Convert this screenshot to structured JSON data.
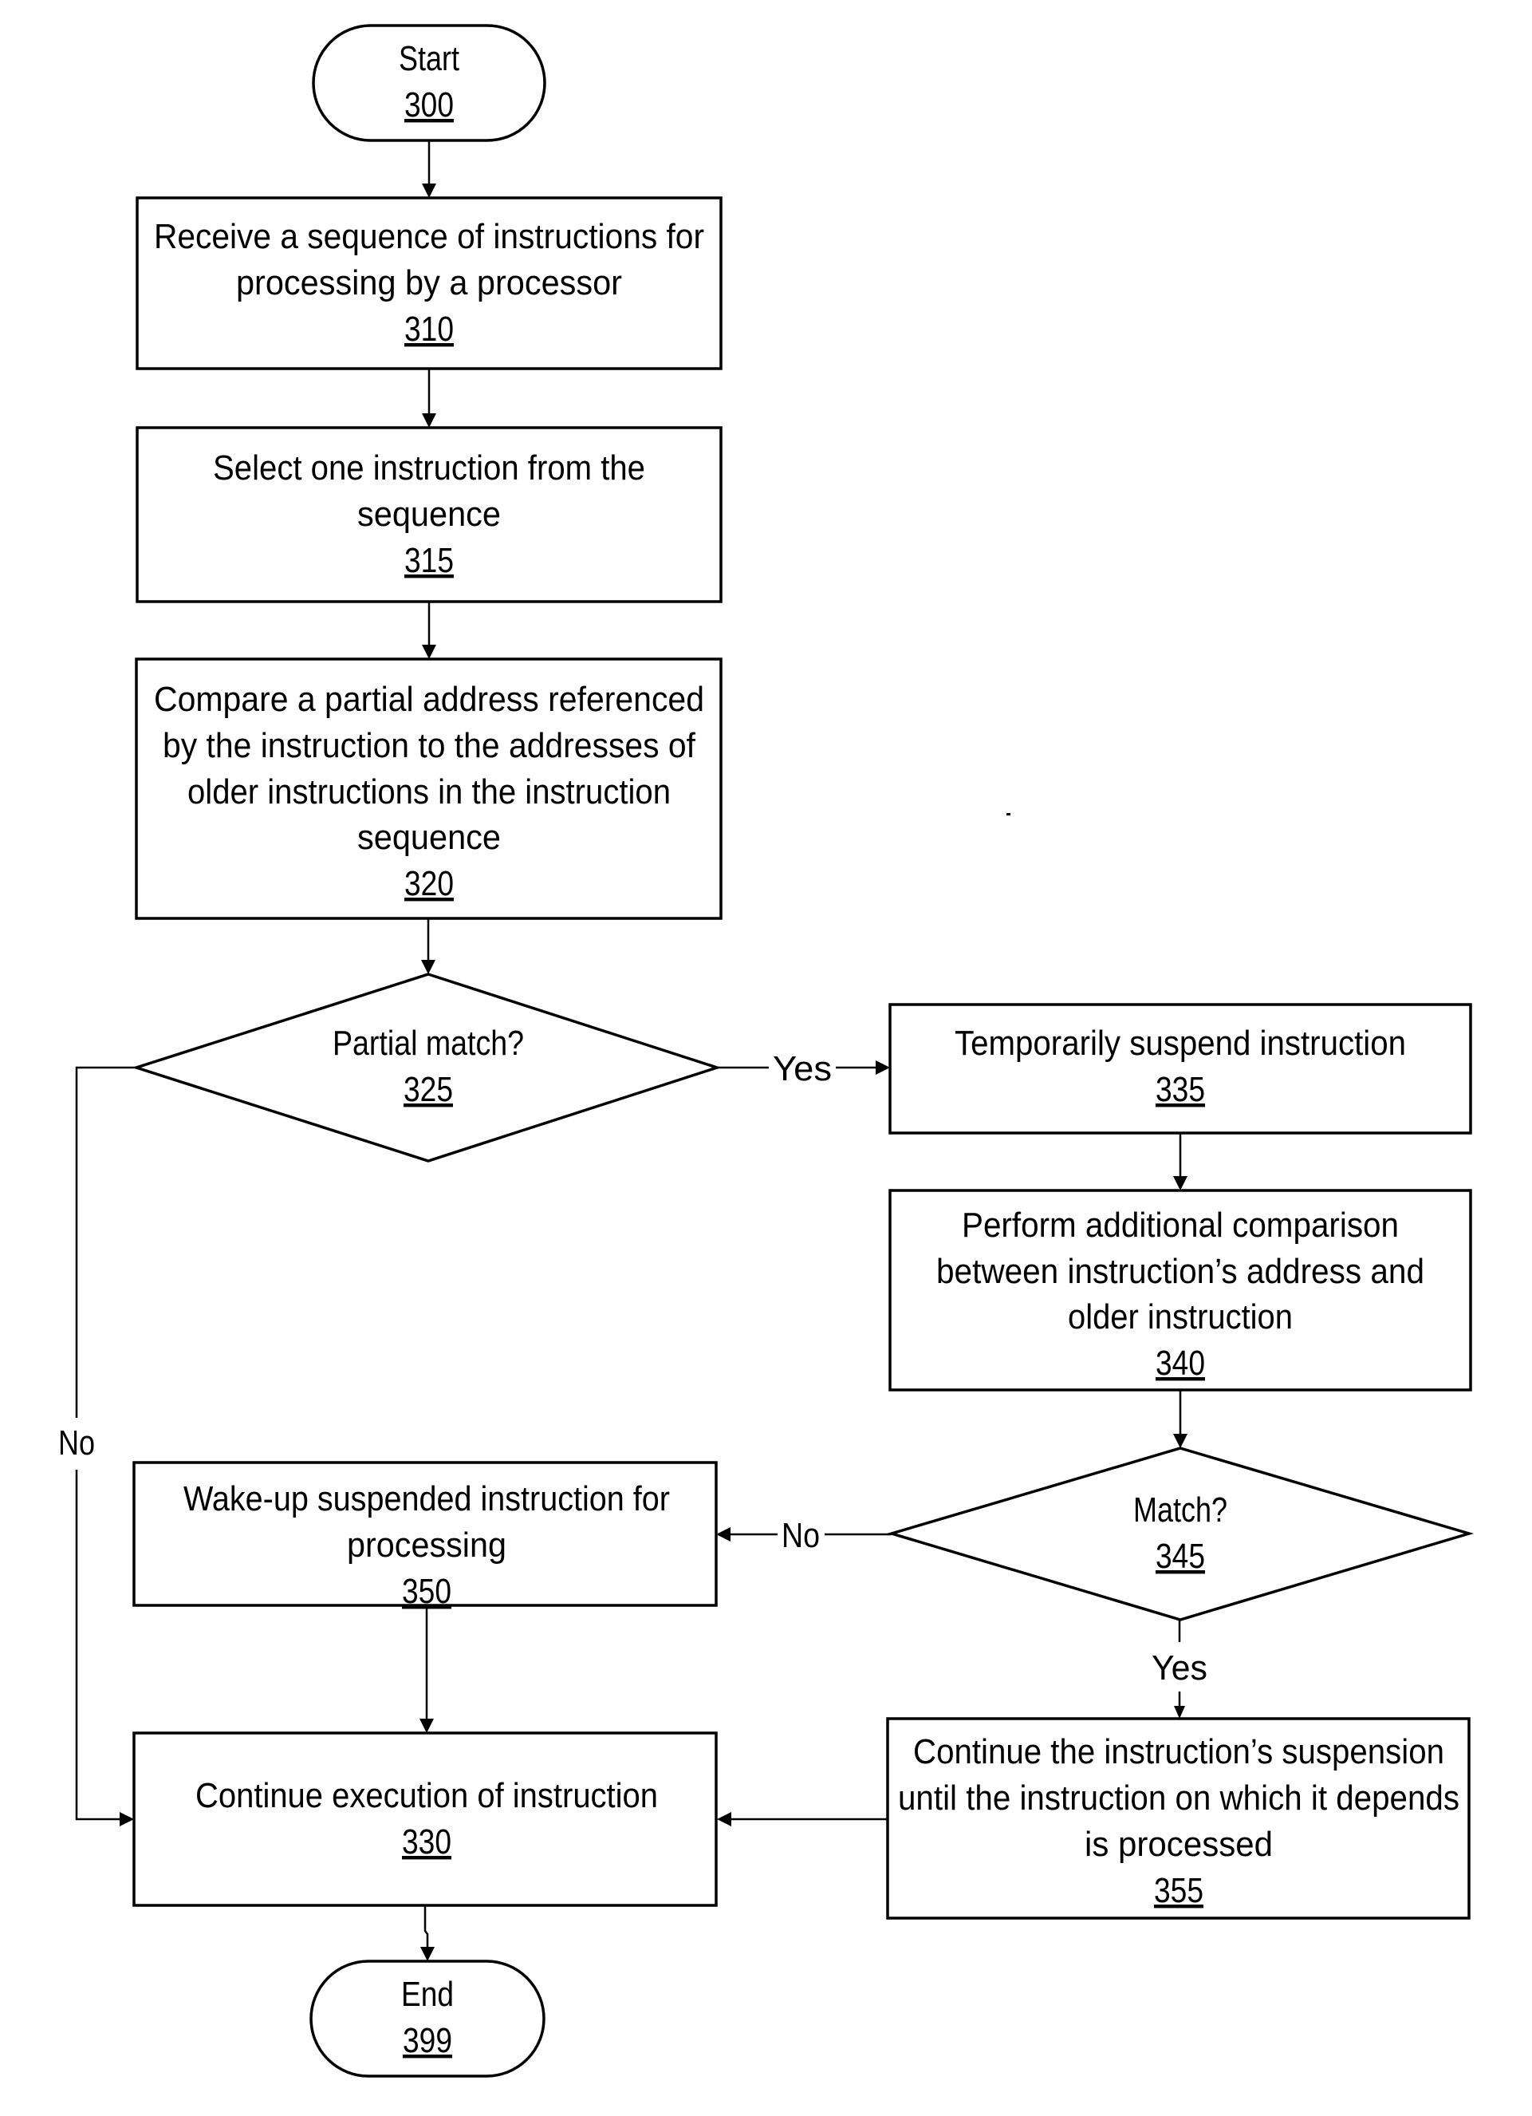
{
  "diagram": {
    "type": "flowchart",
    "nodes": [
      {
        "id": "start",
        "shape": "terminal",
        "lines": [
          "Start"
        ],
        "ref": "300"
      },
      {
        "id": "n310",
        "shape": "process",
        "lines": [
          "Receive a sequence of instructions for",
          "processing by a processor"
        ],
        "ref": "310"
      },
      {
        "id": "n315",
        "shape": "process",
        "lines": [
          "Select one instruction from the",
          "sequence"
        ],
        "ref": "315"
      },
      {
        "id": "n320",
        "shape": "process",
        "lines": [
          "Compare a partial address referenced",
          "by the instruction to the addresses of",
          "older instructions in the instruction",
          "sequence"
        ],
        "ref": "320"
      },
      {
        "id": "n325",
        "shape": "decision",
        "lines": [
          "Partial match?"
        ],
        "ref": "325"
      },
      {
        "id": "n335",
        "shape": "process",
        "lines": [
          "Temporarily suspend instruction"
        ],
        "ref": "335"
      },
      {
        "id": "n340",
        "shape": "process",
        "lines": [
          "Perform additional comparison",
          "between instruction’s address and",
          "older instruction"
        ],
        "ref": "340"
      },
      {
        "id": "n345",
        "shape": "decision",
        "lines": [
          "Match?"
        ],
        "ref": "345"
      },
      {
        "id": "n350",
        "shape": "process",
        "lines": [
          "Wake-up suspended instruction for",
          "processing"
        ],
        "ref": "350"
      },
      {
        "id": "n330",
        "shape": "process",
        "lines": [
          "Continue execution of instruction"
        ],
        "ref": "330"
      },
      {
        "id": "n355",
        "shape": "process",
        "lines": [
          "Continue the instruction’s suspension",
          "until the instruction on which it depends",
          "is processed"
        ],
        "ref": "355"
      },
      {
        "id": "end",
        "shape": "terminal",
        "lines": [
          "End"
        ],
        "ref": "399"
      }
    ],
    "edges": [
      {
        "from": "start",
        "to": "n310",
        "label": ""
      },
      {
        "from": "n310",
        "to": "n315",
        "label": ""
      },
      {
        "from": "n315",
        "to": "n320",
        "label": ""
      },
      {
        "from": "n320",
        "to": "n325",
        "label": ""
      },
      {
        "from": "n325",
        "to": "n335",
        "label": "Yes"
      },
      {
        "from": "n325",
        "to": "n330",
        "label": "No"
      },
      {
        "from": "n335",
        "to": "n340",
        "label": ""
      },
      {
        "from": "n340",
        "to": "n345",
        "label": ""
      },
      {
        "from": "n345",
        "to": "n350",
        "label": "No"
      },
      {
        "from": "n345",
        "to": "n355",
        "label": "Yes"
      },
      {
        "from": "n350",
        "to": "n330",
        "label": ""
      },
      {
        "from": "n355",
        "to": "n330",
        "label": ""
      },
      {
        "from": "n330",
        "to": "end",
        "label": ""
      }
    ]
  }
}
